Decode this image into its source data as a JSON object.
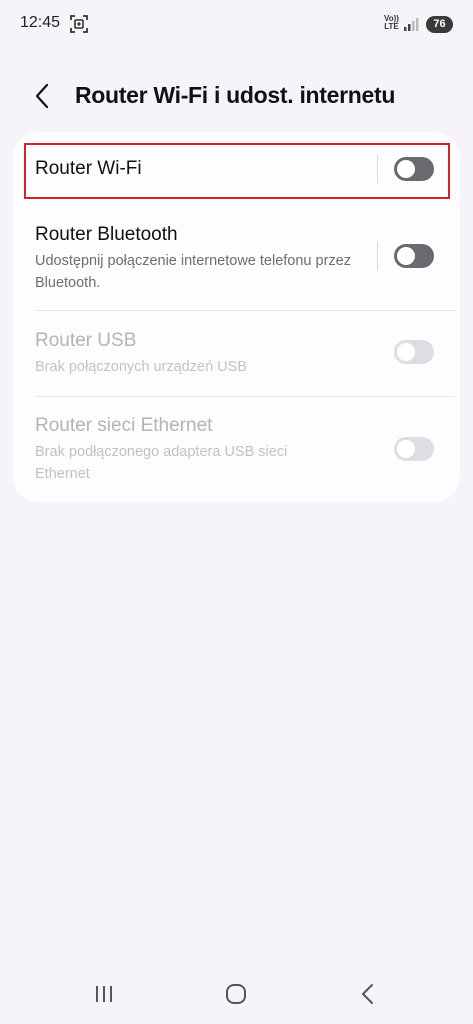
{
  "status": {
    "time": "12:45",
    "volte_line1": "Vo))",
    "volte_line2": "LTE",
    "battery": "76"
  },
  "header": {
    "title": "Router Wi-Fi i udost. internetu"
  },
  "rows": [
    {
      "title": "Router Wi-Fi",
      "subtitle": "",
      "enabled": true,
      "on": false
    },
    {
      "title": "Router Bluetooth",
      "subtitle": "Udostępnij połączenie internetowe telefonu przez Bluetooth.",
      "enabled": true,
      "on": false
    },
    {
      "title": "Router USB",
      "subtitle": "Brak połączonych urządzeń USB",
      "enabled": false,
      "on": false
    },
    {
      "title": "Router sieci Ethernet",
      "subtitle": "Brak podłączonego adaptera USB sieci Ethernet",
      "enabled": false,
      "on": false
    }
  ],
  "colors": {
    "background": "#f6f4f8",
    "card": "#fdfcff",
    "highlight": "#d2232a",
    "toggle_off": "#6a6a6e",
    "toggle_disabled": "#dedee2"
  },
  "icons": {
    "back": "back-arrow-icon",
    "recents": "recent-apps-icon",
    "home": "home-icon",
    "nav_back": "nav-back-icon"
  }
}
